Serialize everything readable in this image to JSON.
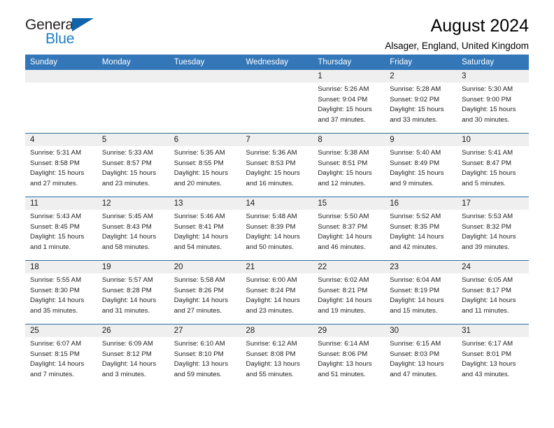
{
  "logo": {
    "word1": "General",
    "word2": "Blue",
    "accent_color": "#1064ab"
  },
  "header": {
    "title": "August 2024",
    "subtitle": "Alsager, England, United Kingdom"
  },
  "calendar": {
    "header_bg": "#3377b8",
    "daynum_bg": "#efefef",
    "row_border_color": "#2e6da4",
    "weekday_headers": [
      "Sunday",
      "Monday",
      "Tuesday",
      "Wednesday",
      "Thursday",
      "Friday",
      "Saturday"
    ],
    "weeks": [
      [
        {
          "day": "",
          "empty": true
        },
        {
          "day": "",
          "empty": true
        },
        {
          "day": "",
          "empty": true
        },
        {
          "day": "",
          "empty": true
        },
        {
          "day": "1",
          "sunrise": "Sunrise: 5:26 AM",
          "sunset": "Sunset: 9:04 PM",
          "daylight": "Daylight: 15 hours and 37 minutes."
        },
        {
          "day": "2",
          "sunrise": "Sunrise: 5:28 AM",
          "sunset": "Sunset: 9:02 PM",
          "daylight": "Daylight: 15 hours and 33 minutes."
        },
        {
          "day": "3",
          "sunrise": "Sunrise: 5:30 AM",
          "sunset": "Sunset: 9:00 PM",
          "daylight": "Daylight: 15 hours and 30 minutes."
        }
      ],
      [
        {
          "day": "4",
          "sunrise": "Sunrise: 5:31 AM",
          "sunset": "Sunset: 8:58 PM",
          "daylight": "Daylight: 15 hours and 27 minutes."
        },
        {
          "day": "5",
          "sunrise": "Sunrise: 5:33 AM",
          "sunset": "Sunset: 8:57 PM",
          "daylight": "Daylight: 15 hours and 23 minutes."
        },
        {
          "day": "6",
          "sunrise": "Sunrise: 5:35 AM",
          "sunset": "Sunset: 8:55 PM",
          "daylight": "Daylight: 15 hours and 20 minutes."
        },
        {
          "day": "7",
          "sunrise": "Sunrise: 5:36 AM",
          "sunset": "Sunset: 8:53 PM",
          "daylight": "Daylight: 15 hours and 16 minutes."
        },
        {
          "day": "8",
          "sunrise": "Sunrise: 5:38 AM",
          "sunset": "Sunset: 8:51 PM",
          "daylight": "Daylight: 15 hours and 12 minutes."
        },
        {
          "day": "9",
          "sunrise": "Sunrise: 5:40 AM",
          "sunset": "Sunset: 8:49 PM",
          "daylight": "Daylight: 15 hours and 9 minutes."
        },
        {
          "day": "10",
          "sunrise": "Sunrise: 5:41 AM",
          "sunset": "Sunset: 8:47 PM",
          "daylight": "Daylight: 15 hours and 5 minutes."
        }
      ],
      [
        {
          "day": "11",
          "sunrise": "Sunrise: 5:43 AM",
          "sunset": "Sunset: 8:45 PM",
          "daylight": "Daylight: 15 hours and 1 minute."
        },
        {
          "day": "12",
          "sunrise": "Sunrise: 5:45 AM",
          "sunset": "Sunset: 8:43 PM",
          "daylight": "Daylight: 14 hours and 58 minutes."
        },
        {
          "day": "13",
          "sunrise": "Sunrise: 5:46 AM",
          "sunset": "Sunset: 8:41 PM",
          "daylight": "Daylight: 14 hours and 54 minutes."
        },
        {
          "day": "14",
          "sunrise": "Sunrise: 5:48 AM",
          "sunset": "Sunset: 8:39 PM",
          "daylight": "Daylight: 14 hours and 50 minutes."
        },
        {
          "day": "15",
          "sunrise": "Sunrise: 5:50 AM",
          "sunset": "Sunset: 8:37 PM",
          "daylight": "Daylight: 14 hours and 46 minutes."
        },
        {
          "day": "16",
          "sunrise": "Sunrise: 5:52 AM",
          "sunset": "Sunset: 8:35 PM",
          "daylight": "Daylight: 14 hours and 42 minutes."
        },
        {
          "day": "17",
          "sunrise": "Sunrise: 5:53 AM",
          "sunset": "Sunset: 8:32 PM",
          "daylight": "Daylight: 14 hours and 39 minutes."
        }
      ],
      [
        {
          "day": "18",
          "sunrise": "Sunrise: 5:55 AM",
          "sunset": "Sunset: 8:30 PM",
          "daylight": "Daylight: 14 hours and 35 minutes."
        },
        {
          "day": "19",
          "sunrise": "Sunrise: 5:57 AM",
          "sunset": "Sunset: 8:28 PM",
          "daylight": "Daylight: 14 hours and 31 minutes."
        },
        {
          "day": "20",
          "sunrise": "Sunrise: 5:58 AM",
          "sunset": "Sunset: 8:26 PM",
          "daylight": "Daylight: 14 hours and 27 minutes."
        },
        {
          "day": "21",
          "sunrise": "Sunrise: 6:00 AM",
          "sunset": "Sunset: 8:24 PM",
          "daylight": "Daylight: 14 hours and 23 minutes."
        },
        {
          "day": "22",
          "sunrise": "Sunrise: 6:02 AM",
          "sunset": "Sunset: 8:21 PM",
          "daylight": "Daylight: 14 hours and 19 minutes."
        },
        {
          "day": "23",
          "sunrise": "Sunrise: 6:04 AM",
          "sunset": "Sunset: 8:19 PM",
          "daylight": "Daylight: 14 hours and 15 minutes."
        },
        {
          "day": "24",
          "sunrise": "Sunrise: 6:05 AM",
          "sunset": "Sunset: 8:17 PM",
          "daylight": "Daylight: 14 hours and 11 minutes."
        }
      ],
      [
        {
          "day": "25",
          "sunrise": "Sunrise: 6:07 AM",
          "sunset": "Sunset: 8:15 PM",
          "daylight": "Daylight: 14 hours and 7 minutes."
        },
        {
          "day": "26",
          "sunrise": "Sunrise: 6:09 AM",
          "sunset": "Sunset: 8:12 PM",
          "daylight": "Daylight: 14 hours and 3 minutes."
        },
        {
          "day": "27",
          "sunrise": "Sunrise: 6:10 AM",
          "sunset": "Sunset: 8:10 PM",
          "daylight": "Daylight: 13 hours and 59 minutes."
        },
        {
          "day": "28",
          "sunrise": "Sunrise: 6:12 AM",
          "sunset": "Sunset: 8:08 PM",
          "daylight": "Daylight: 13 hours and 55 minutes."
        },
        {
          "day": "29",
          "sunrise": "Sunrise: 6:14 AM",
          "sunset": "Sunset: 8:06 PM",
          "daylight": "Daylight: 13 hours and 51 minutes."
        },
        {
          "day": "30",
          "sunrise": "Sunrise: 6:15 AM",
          "sunset": "Sunset: 8:03 PM",
          "daylight": "Daylight: 13 hours and 47 minutes."
        },
        {
          "day": "31",
          "sunrise": "Sunrise: 6:17 AM",
          "sunset": "Sunset: 8:01 PM",
          "daylight": "Daylight: 13 hours and 43 minutes."
        }
      ]
    ]
  }
}
